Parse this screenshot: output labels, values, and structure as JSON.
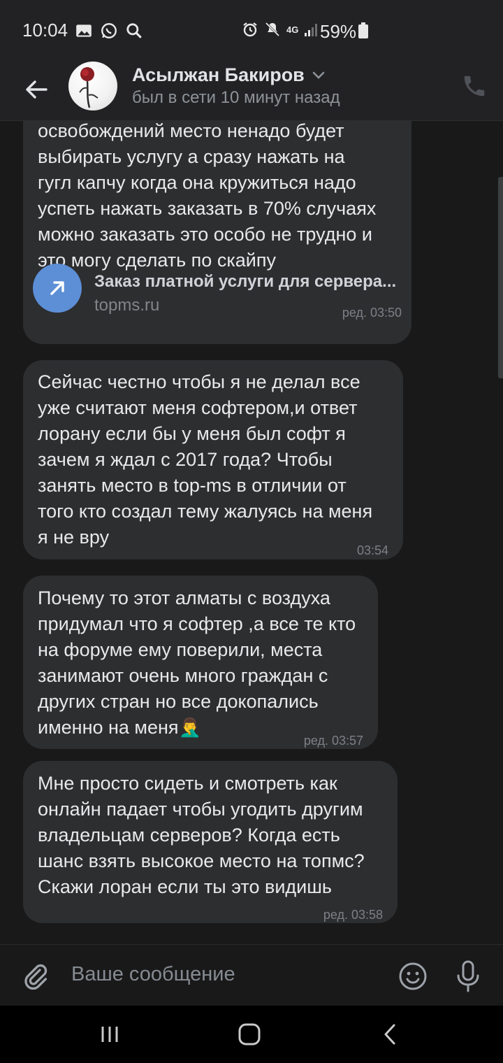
{
  "status_bar": {
    "time": "10:04",
    "battery_pct": "59%",
    "network": "4G",
    "icons": [
      "gallery-icon",
      "whatsapp-icon",
      "search-icon",
      "alarm-icon",
      "mute-icon",
      "network-4g-icon",
      "signal-icon",
      "battery-icon"
    ]
  },
  "header": {
    "name": "Асылжан Бакиров",
    "last_seen": "был в сети 10 минут назад"
  },
  "messages": [
    {
      "lines": [
        "освобождений место ненадо будет",
        "выбирать услугу а сразу нажать на",
        "гугл капчу когда она кружиться надо",
        "успеть нажать заказать в 70% случаях",
        "можно заказать это особо не трудно и",
        "это могу сделать по скайпу"
      ],
      "link_title": "Заказ платной услуги для сервера...",
      "link_url": "topms.ru",
      "time": "ред. 03:50"
    },
    {
      "lines": [
        "Сейчас честно чтобы я не делал все",
        "уже считают меня софтером,и ответ",
        "лорану если бы у меня был софт я",
        "зачем я ждал с 2017 года? Чтобы",
        "занять место в top-ms в отличии от",
        "того кто создал тему жалуясь на меня",
        "я не вру"
      ],
      "time": "03:54"
    },
    {
      "lines": [
        "Почему то этот алматы с воздуха",
        "придумал что я софтер ,а все те кто",
        "на форуме ему поверили, места",
        "занимают очень много граждан с",
        "других стран но все докопались",
        "именно на меня"
      ],
      "emoji": "🤦‍♂️",
      "time": "ред. 03:57"
    },
    {
      "lines": [
        "Мне просто сидеть и смотреть как",
        "онлайн падает чтобы угодить другим",
        "владельцам серверов? Когда есть",
        "шанс взять высокое место на топмс?",
        "Скажи лоран если ты это видишь"
      ],
      "time": "ред. 03:58"
    }
  ],
  "composer": {
    "placeholder": "Ваше сообщение"
  },
  "colors": {
    "background": "#19191a",
    "bubble": "#2d2e30",
    "link_accent": "#5d8fd6",
    "muted_text": "#8e939a"
  }
}
